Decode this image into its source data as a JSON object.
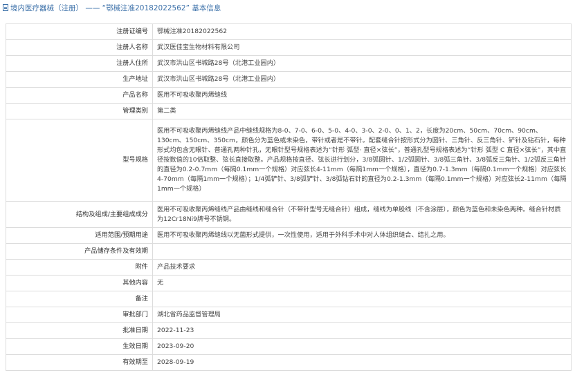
{
  "header": {
    "title": "境内医疗器械（注册） —— “鄂械注准20182022562” 基本信息"
  },
  "rows": [
    {
      "label": "注册证编号",
      "value": "鄂械注准20182022562"
    },
    {
      "label": "注册人名称",
      "value": "武汉医佳宝生物材料有限公司"
    },
    {
      "label": "注册人住所",
      "value": "武汉市洪山区书城路28号（北港工业园内）"
    },
    {
      "label": "生产地址",
      "value": "武汉市洪山区书城路28号（北港工业园内）"
    },
    {
      "label": "产品名称",
      "value": "医用不可吸收聚丙烯缝线"
    },
    {
      "label": "管理类别",
      "value": "第二类"
    },
    {
      "label": "型号规格",
      "value": "医用不可吸收聚丙烯缝线产品中缝线规格为8-0、7-0、6-0、5-0、4-0、3-0、2-0、0、1、2，长度为20cm、50cm、70cm、90cm、130cm、150cm、350cm，颜色分为蓝色或未染色，带针或者是不带针。配套缝合针按形式分为圆针、三角针、反三角针、铲针及钻石针，每种形式均包含无眼针、普通孔两种针孔，无眼针型号规格表述为“针形 弧型· 直径×弦长”，普通孔型号规格表述为“针形 弧型 C 直径×弦长”，其中直径按数值的10倍取整、弦长直接取整。产品规格按直径、弦长进行划分，3/8弧圆针、1/2弧圆针、3/8弧三角针、3/8弧反三角针、1/2弧反三角针的直径为0.2-0.7mm（每隔0.1mm一个规格）对应弦长4-11mm（每隔1mm一个规格），直径为0.7-1.3mm（每隔0.1mm一个规格）对应弦长4-70mm（每隔1mm一个规格）；1/4弧铲针、3/8弧铲针、3/8弧钻石针的直径为0.2-1.3mm（每隔0.1mm一个规格）对应弦长2-11mm（每隔1mm一个规格）"
    },
    {
      "label": "结构及组成/主要组成成分",
      "value": "医用不可吸收聚丙烯缝线产品由缝线和缝合针（不带针型号无缝合针）组成，缝线为单股线（不含涂层），颜色为蓝色和未染色两种。缝合针材质为12Cr18Ni9牌号不锈钢。"
    },
    {
      "label": "适用范围/预期用途",
      "value": "医用不可吸收聚丙烯缝线以无菌形式提供，一次性使用，适用于外科手术中对人体组织缝合、结扎之用。"
    },
    {
      "label": "产品储存条件及有效期",
      "value": ""
    },
    {
      "label": "附件",
      "value": "产品技术要求"
    },
    {
      "label": "其他内容",
      "value": "无"
    },
    {
      "label": "备注",
      "value": ""
    },
    {
      "label": "审批部门",
      "value": "湖北省药品监督管理局"
    },
    {
      "label": "批准日期",
      "value": "2022-11-23"
    },
    {
      "label": "生效日期",
      "value": "2023-09-20"
    },
    {
      "label": "有效期至",
      "value": "2028-09-19"
    }
  ]
}
